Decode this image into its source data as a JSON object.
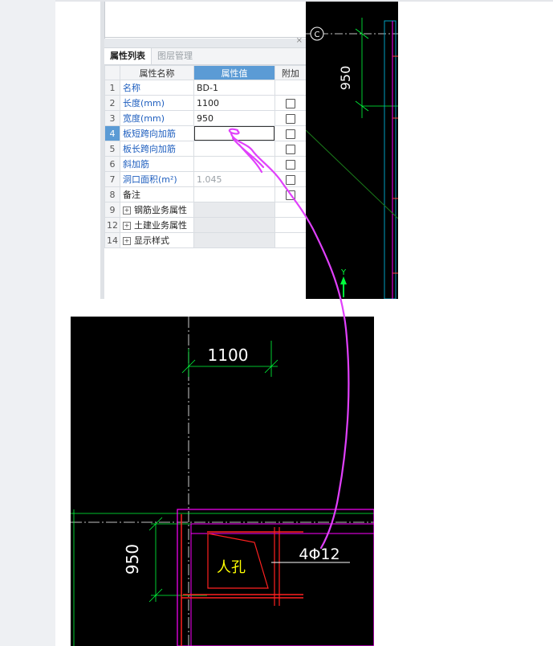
{
  "panel": {
    "tabs": [
      "属性列表",
      "图层管理"
    ],
    "close_glyph": "×",
    "columns": {
      "name": "属性名称",
      "value": "属性值",
      "extra": "附加"
    },
    "rows": [
      {
        "num": "1",
        "name": "名称",
        "value": "BD-1",
        "checkbox": false
      },
      {
        "num": "2",
        "name": "长度(mm)",
        "value": "1100",
        "checkbox": true
      },
      {
        "num": "3",
        "name": "宽度(mm)",
        "value": "950",
        "checkbox": true
      },
      {
        "num": "4",
        "name": "板短跨向加筋",
        "value": "",
        "checkbox": true
      },
      {
        "num": "5",
        "name": "板长跨向加筋",
        "value": "",
        "checkbox": true
      },
      {
        "num": "6",
        "name": "斜加筋",
        "value": "",
        "checkbox": true
      },
      {
        "num": "7",
        "name": "洞口面积(m²)",
        "value": "1.045",
        "checkbox": true
      },
      {
        "num": "8",
        "name": "备注",
        "value": "",
        "checkbox": true
      },
      {
        "num": "9",
        "name": "钢筋业务属性",
        "value": "",
        "checkbox": false
      },
      {
        "num": "12",
        "name": "土建业务属性",
        "value": "",
        "checkbox": false
      },
      {
        "num": "14",
        "name": "显示样式",
        "value": "",
        "checkbox": false
      }
    ]
  },
  "cad_top": {
    "axis_bubble": "C",
    "dimension": "950",
    "y_axis": "Y"
  },
  "cad_bottom": {
    "dim_length": "1100",
    "dim_width": "950",
    "hole_label": "人孔",
    "rebar_label": "4Φ12"
  },
  "colors": {
    "cad_bg": "#000000",
    "dim_green": "#00ff3c",
    "wall_magenta": "#ff00ff",
    "rebar_red": "#ff2020",
    "hole_yellow": "#ffff00",
    "annotation": "#e040fb",
    "selected_blue": "#5b9bd5"
  }
}
